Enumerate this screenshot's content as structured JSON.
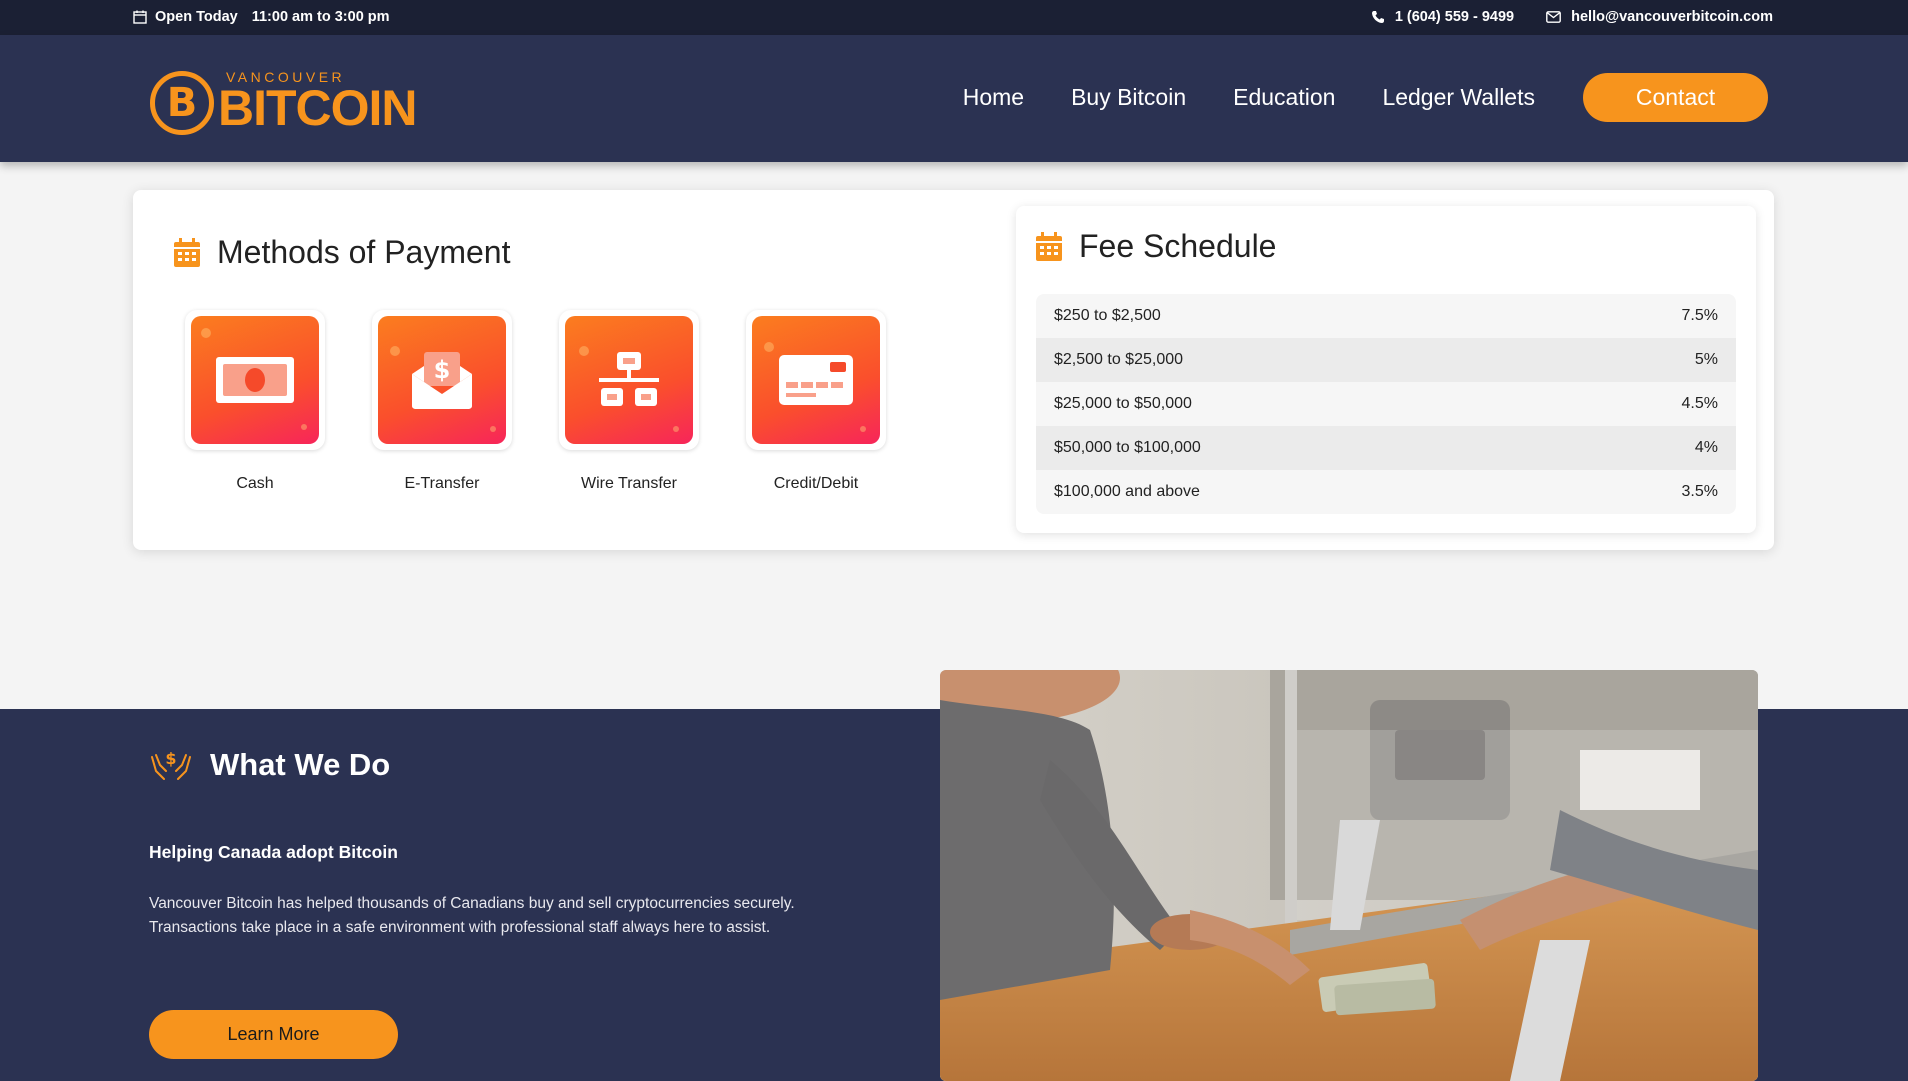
{
  "topbar": {
    "hours_label": "Open Today",
    "hours_value": "11:00 am to 3:00 pm",
    "phone": "1 (604) 559 - 9499",
    "email": "hello@vancouverbitcoin.com"
  },
  "logo": {
    "small": "VANCOUVER",
    "big": "BITCOIN",
    "mark": "B"
  },
  "nav": {
    "items": [
      "Home",
      "Buy Bitcoin",
      "Education",
      "Ledger Wallets"
    ],
    "contact": "Contact"
  },
  "payment": {
    "title": "Methods of Payment",
    "methods": [
      {
        "label": "Cash",
        "icon": "cash-icon"
      },
      {
        "label": "E-Transfer",
        "icon": "envelope-dollar-icon"
      },
      {
        "label": "Wire Transfer",
        "icon": "network-icon"
      },
      {
        "label": "Credit/Debit",
        "icon": "credit-card-icon"
      }
    ]
  },
  "fees": {
    "title": "Fee Schedule",
    "rows": [
      {
        "range": "$250 to $2,500",
        "fee": "7.5%"
      },
      {
        "range": "$2,500 to $25,000",
        "fee": "5%"
      },
      {
        "range": "$25,000 to $50,000",
        "fee": "4.5%"
      },
      {
        "range": "$50,000 to $100,000",
        "fee": "4%"
      },
      {
        "range": "$100,000 and above",
        "fee": "3.5%"
      }
    ]
  },
  "what_we_do": {
    "title": "What We Do",
    "subtitle": "Helping Canada adopt Bitcoin",
    "text": "Vancouver Bitcoin has helped thousands of Canadians buy and sell cryptocurrencies securely. Transactions take place in a safe environment with professional staff always here to assist.",
    "button": "Learn More"
  },
  "colors": {
    "navy": "#2b3252",
    "dark_navy": "#1b2034",
    "accent": "#f7941d"
  }
}
